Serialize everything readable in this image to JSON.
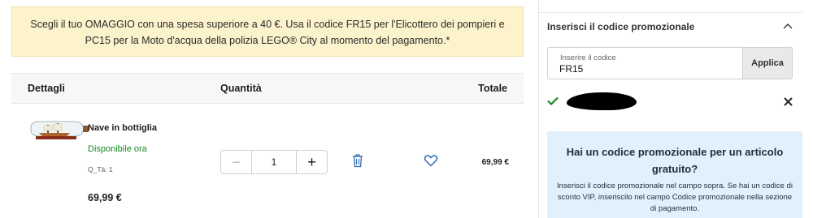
{
  "banner": {
    "line1": "Scegli il tuo OMAGGIO con una spesa superiore a 40 €. Usa il codice FR15 per l'Elicottero dei pompieri e",
    "line2": "PC15 per la Moto d'acqua della polizia LEGO® City al momento del pagamento.*"
  },
  "table": {
    "col_details": "Dettagli",
    "col_quantity": "Quantità",
    "col_total": "Totale"
  },
  "item": {
    "name": "Nave in bottiglia",
    "availability": "Disponibile ora",
    "qty_label": "Q_Tà: 1",
    "price": "69,99 €",
    "quantity": "1",
    "minus": "−",
    "plus": "+",
    "line_total": "69,99 €",
    "thumbnail_icon": "ship-in-bottle-image",
    "delete_icon": "trash-icon",
    "wishlist_icon": "heart-icon"
  },
  "promo": {
    "title": "Inserisci il codice promozionale",
    "toggle_icon": "chevron-up-icon",
    "field_label": "Inserire il codice",
    "code_value": "FR15",
    "apply_label": "Applica",
    "status_icon": "check-icon",
    "remove_icon": "close-icon"
  },
  "info": {
    "heading": "Hai un codice promozionale per un articolo gratuito?",
    "text": "Inserisci il codice promozionale nel campo sopra. Se hai un codice di sconto VIP, inseriscilo nel campo Codice promozionale nella sezione di pagamento."
  },
  "colors": {
    "banner_bg": "#fcf2cc",
    "available_green": "#178b22",
    "icon_blue": "#2b6cb0",
    "info_bg": "#e2f0fb"
  }
}
